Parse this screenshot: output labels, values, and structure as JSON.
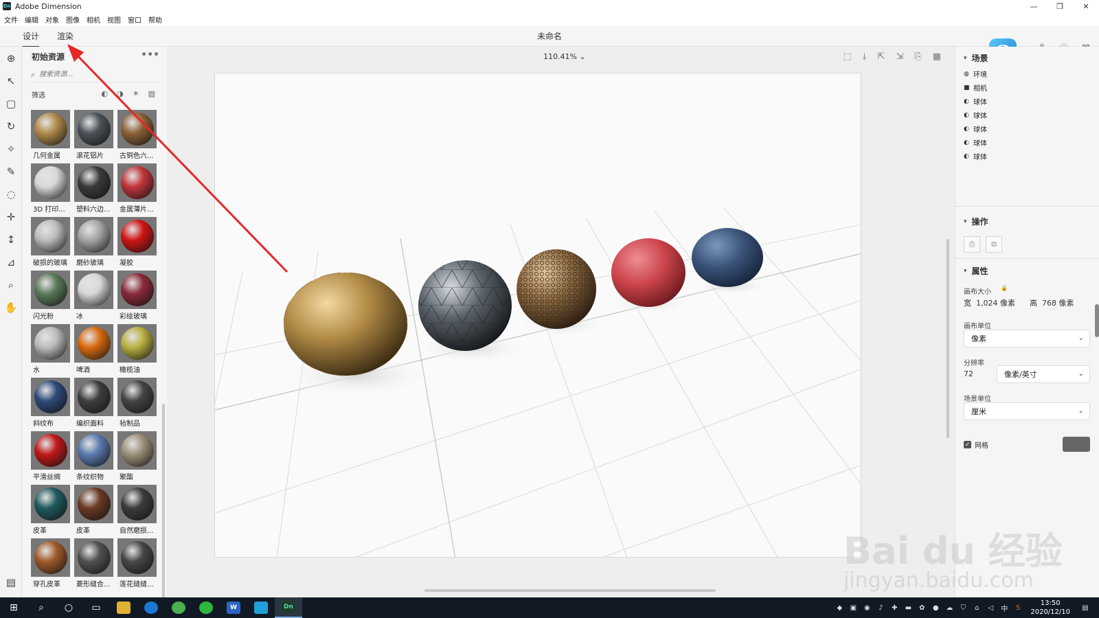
{
  "window": {
    "app_name": "Adobe Dimension",
    "app_icon_label": "Dn",
    "controls": {
      "minimize": "—",
      "restore": "❐",
      "close": "✕"
    }
  },
  "menu": [
    "文件",
    "编辑",
    "对象",
    "图像",
    "相机",
    "视图",
    "窗口",
    "帮助"
  ],
  "modes": {
    "design": "设计",
    "render": "渲染"
  },
  "document_title": "未命名",
  "cc_badge_letter": "S",
  "assets": {
    "title": "初始资源",
    "more": "•••",
    "search_placeholder": "搜索资源...",
    "filter_label": "筛选",
    "items": [
      {
        "name": "几何金属",
        "color": "#b08a4a"
      },
      {
        "name": "滚花铝片",
        "color": "#4b5258"
      },
      {
        "name": "古铜色六...",
        "color": "#8d6237"
      },
      {
        "name": "3D 打印...",
        "color": "#d9d9d9"
      },
      {
        "name": "塑料六边...",
        "color": "#3a3a3a"
      },
      {
        "name": "金属薄片...",
        "color": "#c2353b"
      },
      {
        "name": "破损的玻璃",
        "color": "#bdbdbd"
      },
      {
        "name": "磨砂玻璃",
        "color": "#a6a6a6"
      },
      {
        "name": "凝胶",
        "color": "#d01515"
      },
      {
        "name": "闪光粉",
        "color": "#5a7a5a"
      },
      {
        "name": "冰",
        "color": "#d8d8d8"
      },
      {
        "name": "彩绘玻璃",
        "color": "#8a2a3a"
      },
      {
        "name": "水",
        "color": "#bcbcbc"
      },
      {
        "name": "啤酒",
        "color": "#d96a10"
      },
      {
        "name": "橄榄油",
        "color": "#b8b040"
      },
      {
        "name": "斜纹布",
        "color": "#2e4a7a"
      },
      {
        "name": "编织面料",
        "color": "#3f3f3f"
      },
      {
        "name": "毡制品",
        "color": "#454545"
      },
      {
        "name": "平滑丝绸",
        "color": "#c01818"
      },
      {
        "name": "条纹织物",
        "color": "#5a7ab0"
      },
      {
        "name": "聚酯",
        "color": "#9c9078"
      },
      {
        "name": "皮革",
        "color": "#1e5a5e"
      },
      {
        "name": "皮革",
        "color": "#6a3a24"
      },
      {
        "name": "自然磨损...",
        "color": "#3c3c3c"
      },
      {
        "name": "穿孔皮革",
        "color": "#a0592a"
      },
      {
        "name": "菱形缝合...",
        "color": "#505050"
      },
      {
        "name": "莲花缝缝...",
        "color": "#474747"
      }
    ]
  },
  "viewport": {
    "zoom": "110.41%",
    "spheres": [
      {
        "name": "几何金属",
        "color": "#b28b46"
      },
      {
        "name": "滚花铝片",
        "color": "#5a6168"
      },
      {
        "name": "古铜色六边形",
        "color": "#8c6a44"
      },
      {
        "name": "金属薄片",
        "color": "#cc444c"
      },
      {
        "name": "斜纹布",
        "color": "#3a5278"
      }
    ]
  },
  "scene": {
    "title": "场景",
    "items": [
      {
        "label": "环境",
        "icon": "environment-icon"
      },
      {
        "label": "相机",
        "icon": "camera-icon"
      },
      {
        "label": "球体",
        "icon": "sphere-icon"
      },
      {
        "label": "球体",
        "icon": "sphere-icon"
      },
      {
        "label": "球体",
        "icon": "sphere-icon"
      },
      {
        "label": "球体",
        "icon": "sphere-icon"
      },
      {
        "label": "球体",
        "icon": "sphere-icon"
      }
    ]
  },
  "operations": {
    "title": "操作"
  },
  "properties": {
    "title": "属性",
    "canvas_size_label": "画布大小",
    "width_label": "宽",
    "width_value": "1,024 像素",
    "height_label": "高",
    "height_value": "768 像素",
    "canvas_unit_label": "画布单位",
    "canvas_unit_value": "像素",
    "resolution_label": "分辨率",
    "resolution_value": "72",
    "resolution_unit": "像素/英寸",
    "scene_unit_label": "场景单位",
    "scene_unit_value": "厘米",
    "grid_label": "网格",
    "grid_checked": true,
    "grid_color": "#666666"
  },
  "taskbar": {
    "time": "13:50",
    "date": "2020/12/10",
    "lang": "中",
    "active_app": "Dn"
  },
  "watermark": {
    "logo": "Bai du 经验",
    "url": "jingyan.baidu.com"
  }
}
